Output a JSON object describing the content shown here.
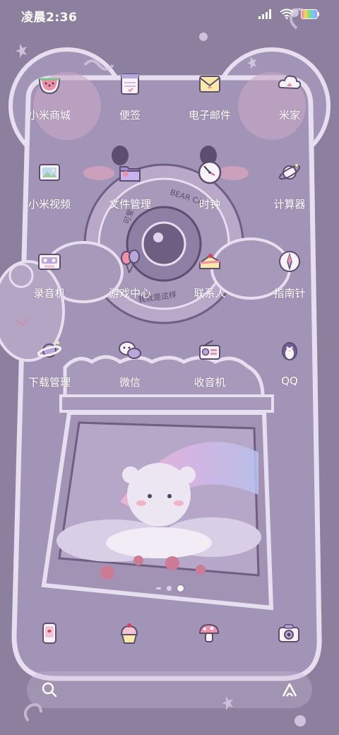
{
  "status_bar": {
    "time": "凌晨2:36"
  },
  "wallpaper_text": {
    "ring_top": "BEAR CA",
    "ring_left": "可爱",
    "ring_bottom": "我就是这样"
  },
  "apps": [
    {
      "label": "小米商城",
      "icon": "watermelon-icon"
    },
    {
      "label": "便签",
      "icon": "notepad-icon"
    },
    {
      "label": "电子邮件",
      "icon": "envelope-icon"
    },
    {
      "label": "米家",
      "icon": "cloud-home-icon"
    },
    {
      "label": "小米视频",
      "icon": "photo-frame-icon"
    },
    {
      "label": "文件管理",
      "icon": "folder-icon"
    },
    {
      "label": "时钟",
      "icon": "clock-icon"
    },
    {
      "label": "计算器",
      "icon": "planet-icon"
    },
    {
      "label": "录音机",
      "icon": "cassette-icon"
    },
    {
      "label": "游戏中心",
      "icon": "balloons-icon"
    },
    {
      "label": "联系人",
      "icon": "cake-icon"
    },
    {
      "label": "指南针",
      "icon": "compass-icon"
    },
    {
      "label": "下载管理",
      "icon": "saturn-icon"
    },
    {
      "label": "微信",
      "icon": "chat-bubbles-icon"
    },
    {
      "label": "收音机",
      "icon": "radio-icon"
    },
    {
      "label": "QQ",
      "icon": "penguin-icon"
    }
  ],
  "dock": [
    {
      "icon": "phone-icon"
    },
    {
      "icon": "message-cupcake-icon"
    },
    {
      "icon": "browser-mushroom-icon"
    },
    {
      "icon": "camera-icon"
    }
  ],
  "page_indicator": {
    "pages": 3,
    "current_page": 3
  },
  "colors": {
    "background": "#8d809f",
    "bear_body": "#a090b4",
    "outline": "#e9e2f1",
    "accent_pink": "#e9b1c8"
  }
}
